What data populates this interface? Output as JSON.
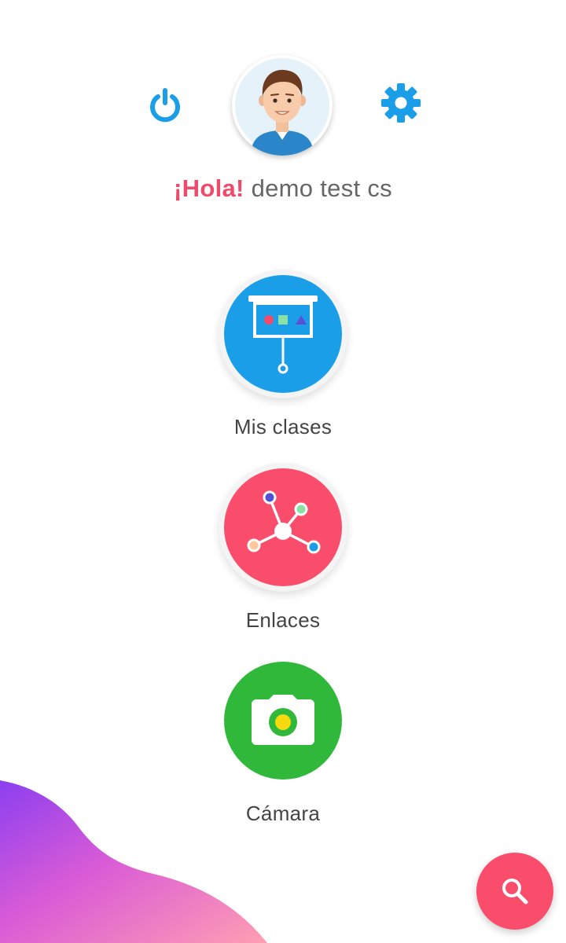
{
  "colors": {
    "accent_blue": "#1a9ee8",
    "accent_pink": "#fa4d6b",
    "accent_green": "#2fb83a",
    "greeting_highlight": "#ee4b6a",
    "label_text": "#444444"
  },
  "header": {
    "greeting_prefix": "¡Hola!",
    "user_name": "demo test cs",
    "power_icon": "power-icon",
    "settings_icon": "gear-icon",
    "avatar_icon": "user-avatar"
  },
  "menu": {
    "items": [
      {
        "label": "Mis clases",
        "icon": "presentation-board-icon",
        "color": "#1a9ee8"
      },
      {
        "label": "Enlaces",
        "icon": "network-links-icon",
        "color": "#fa4d6b"
      },
      {
        "label": "Cámara",
        "icon": "camera-icon",
        "color": "#2fb83a"
      }
    ]
  },
  "fab": {
    "icon": "search-icon",
    "color": "#fa4d6b"
  }
}
